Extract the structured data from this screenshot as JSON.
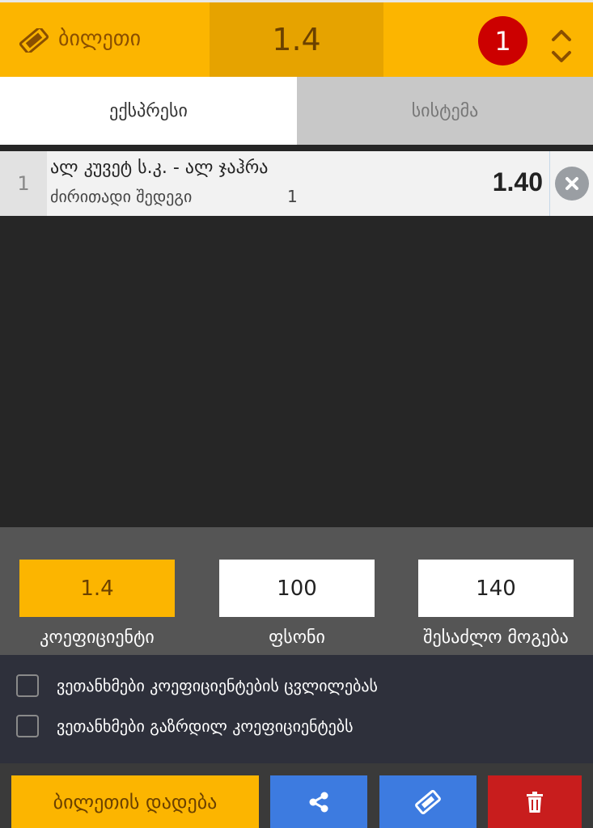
{
  "header": {
    "title": "ბილეთი",
    "total_odds": "1.4",
    "count": "1",
    "icons": {
      "ticket": "ticket-icon",
      "toggle": "expand-collapse-icon"
    }
  },
  "tabs": [
    {
      "label": "ექსპრესი",
      "active": true
    },
    {
      "label": "სისტემა",
      "active": false
    }
  ],
  "bets": [
    {
      "number": "1",
      "match": "ალ კუვეტ ს.კ. - ალ ჯაჰრა",
      "market": "ძირითადი შედეგი",
      "pick": "1",
      "odds": "1.40"
    }
  ],
  "calc": {
    "coefficient": {
      "value": "1.4",
      "label": "კოეფიციენტი"
    },
    "stake": {
      "value": "100",
      "label": "ფსონი"
    },
    "possible_win": {
      "value": "140",
      "label": "შესაძლო მოგება"
    }
  },
  "agreements": [
    {
      "label": "ვეთანხმები კოეფიციენტების ცვლილებას",
      "checked": false
    },
    {
      "label": "ვეთანხმები გაზრდილ კოეფიციენტებს",
      "checked": false
    }
  ],
  "actions": {
    "place_bet": "ბილეთის დადება",
    "icons": [
      "share-icon",
      "ticket-icon",
      "trash-icon"
    ]
  },
  "colors": {
    "accent": "#fcb500",
    "accent_dark": "#e6a300",
    "badge": "#cc0000",
    "action_blue": "#3d7be0",
    "action_red": "#c81d1d"
  }
}
